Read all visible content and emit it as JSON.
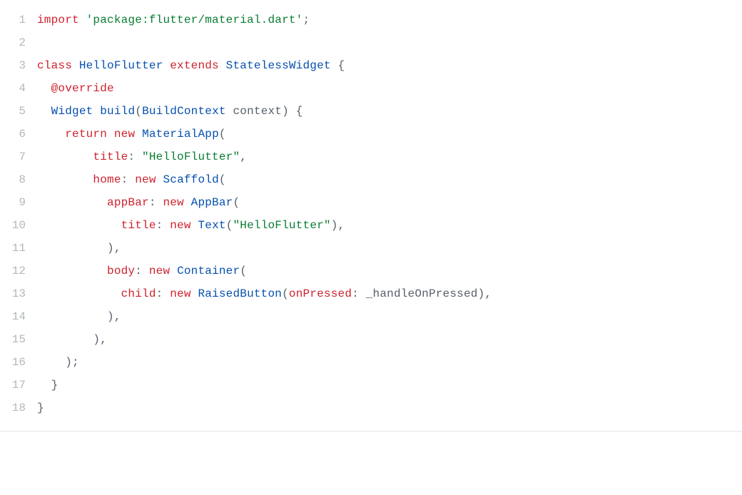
{
  "code": {
    "lineNumbers": [
      "1",
      "2",
      "3",
      "4",
      "5",
      "6",
      "7",
      "8",
      "9",
      "10",
      "11",
      "12",
      "13",
      "14",
      "15",
      "16",
      "17",
      "18"
    ],
    "lines": {
      "l1": {
        "kw_import": "import ",
        "str": "'package:flutter/material.dart'",
        "semi": ";"
      },
      "l2": {
        "blank": ""
      },
      "l3": {
        "kw_class": "class ",
        "type1": "HelloFlutter",
        "sp1": " ",
        "kw_ext": "extends ",
        "type2": "StatelessWidget",
        "sp2": " ",
        "brace": "{"
      },
      "l4": {
        "indent": "  ",
        "ann": "@override"
      },
      "l5": {
        "indent": "  ",
        "type_w": "Widget",
        "sp1": " ",
        "fn": "build",
        "open": "(",
        "type_bc": "BuildContext",
        "sp2": " ",
        "arg": "context",
        "close": ") {"
      },
      "l6": {
        "indent": "    ",
        "kw_ret": "return ",
        "kw_new": "new ",
        "type": "MaterialApp",
        "open": "("
      },
      "l7": {
        "indent": "        ",
        "label": "title",
        "colon": ": ",
        "str": "\"HelloFlutter\"",
        "comma": ","
      },
      "l8": {
        "indent": "        ",
        "label": "home",
        "colon": ": ",
        "kw_new": "new ",
        "type": "Scaffold",
        "open": "("
      },
      "l9": {
        "indent": "          ",
        "label": "appBar",
        "colon": ": ",
        "kw_new": "new ",
        "type": "AppBar",
        "open": "("
      },
      "l10": {
        "indent": "            ",
        "label": "title",
        "colon": ": ",
        "kw_new": "new ",
        "type": "Text",
        "open": "(",
        "str": "\"HelloFlutter\"",
        "close": "),"
      },
      "l11": {
        "indent": "          ",
        "close": "),"
      },
      "l12": {
        "indent": "          ",
        "label": "body",
        "colon": ": ",
        "kw_new": "new ",
        "type": "Container",
        "open": "("
      },
      "l13": {
        "indent": "            ",
        "label": "child",
        "colon": ": ",
        "kw_new": "new ",
        "type": "RaisedButton",
        "open": "(",
        "arglabel": "onPressed",
        "colon2": ": ",
        "arg": "_handleOnPressed",
        "close": "),"
      },
      "l14": {
        "indent": "          ",
        "close": "),"
      },
      "l15": {
        "indent": "        ",
        "close": "),"
      },
      "l16": {
        "indent": "    ",
        "close": ");"
      },
      "l17": {
        "indent": "  ",
        "close": "}"
      },
      "l18": {
        "close": "}"
      }
    }
  }
}
